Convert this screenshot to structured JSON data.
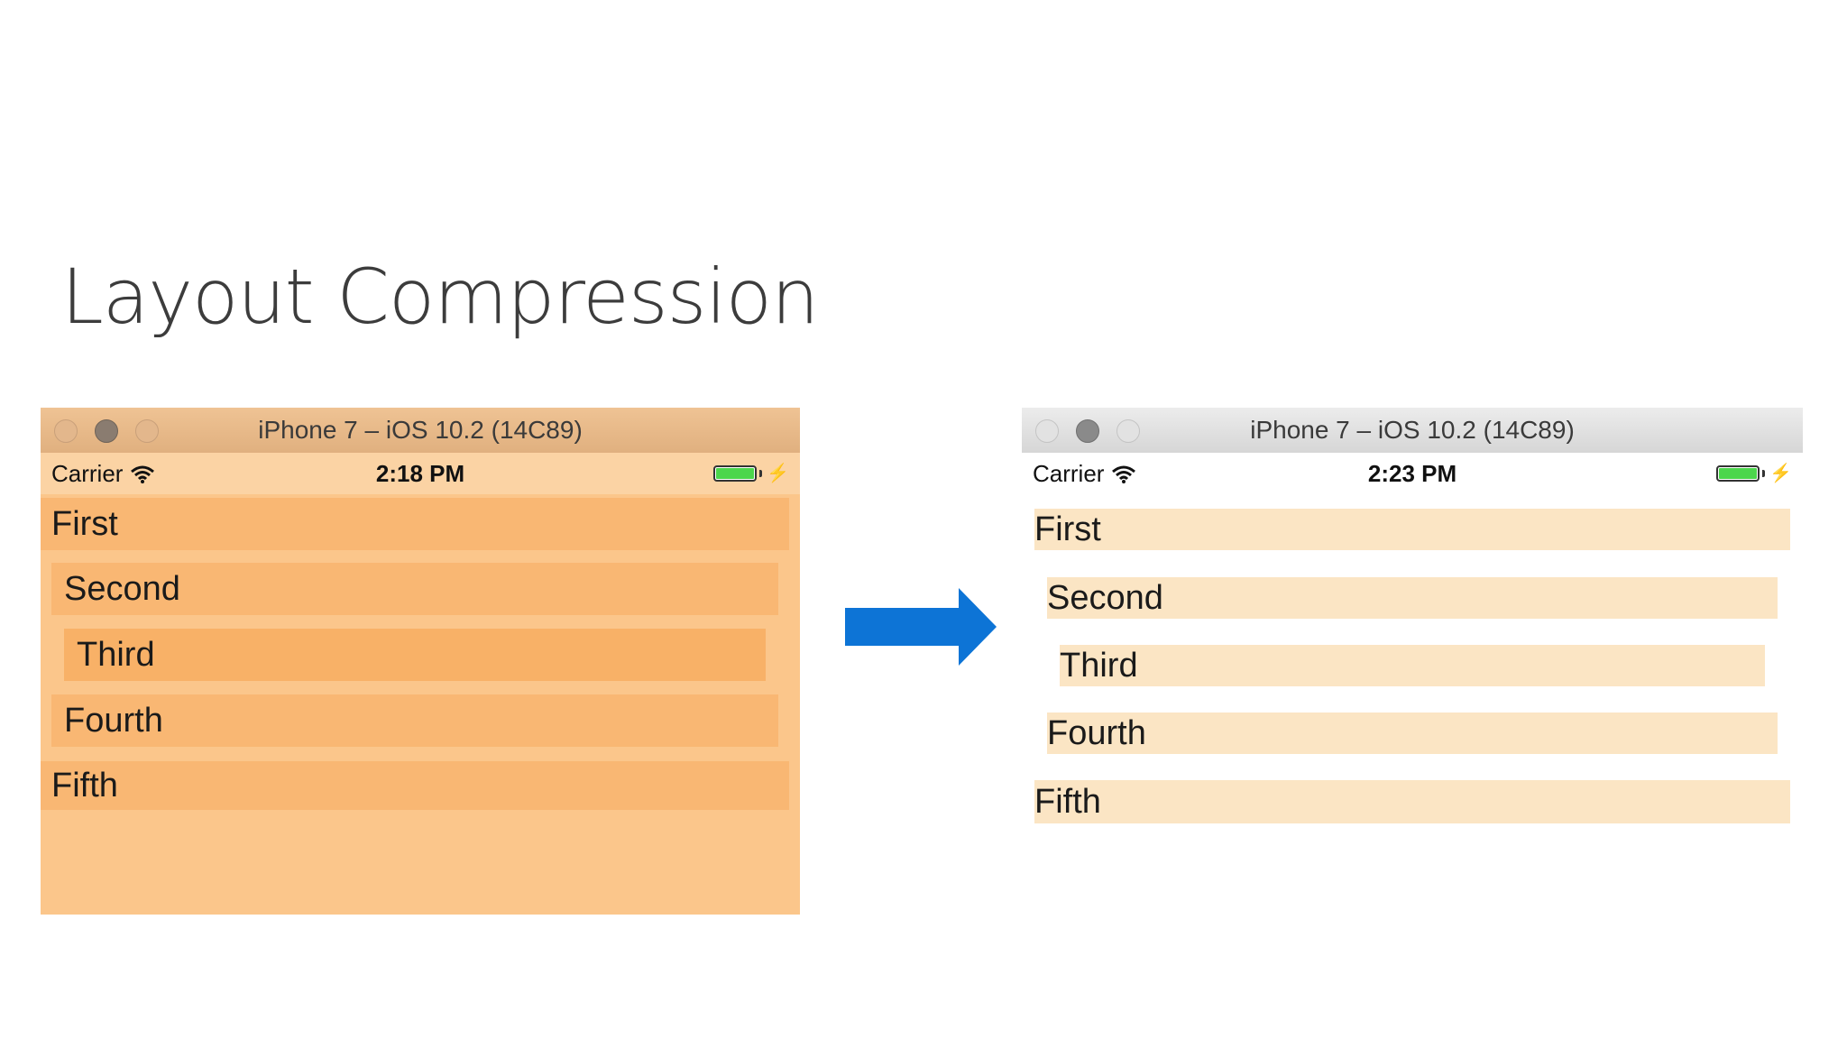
{
  "slide": {
    "title": "Layout Compression"
  },
  "left_simulator": {
    "window_title": "iPhone 7 – iOS 10.2 (14C89)",
    "carrier": "Carrier",
    "time": "2:18 PM",
    "rows": [
      "First",
      "Second",
      "Third",
      "Fourth",
      "Fifth"
    ]
  },
  "right_simulator": {
    "window_title": "iPhone 7 – iOS 10.2 (14C89)",
    "carrier": "Carrier",
    "time": "2:23 PM",
    "rows": [
      "First",
      "Second",
      "Third",
      "Fourth",
      "Fifth"
    ]
  },
  "icons": {
    "wifi": "wifi-icon",
    "battery": "battery-icon",
    "charging": "charging-bolt-icon",
    "arrow": "right-arrow-icon"
  },
  "colors": {
    "left_background": "#fbc68b",
    "right_row_background": "#fbe5c4",
    "arrow": "#0d74d6",
    "battery_fill": "#4cd64c"
  }
}
